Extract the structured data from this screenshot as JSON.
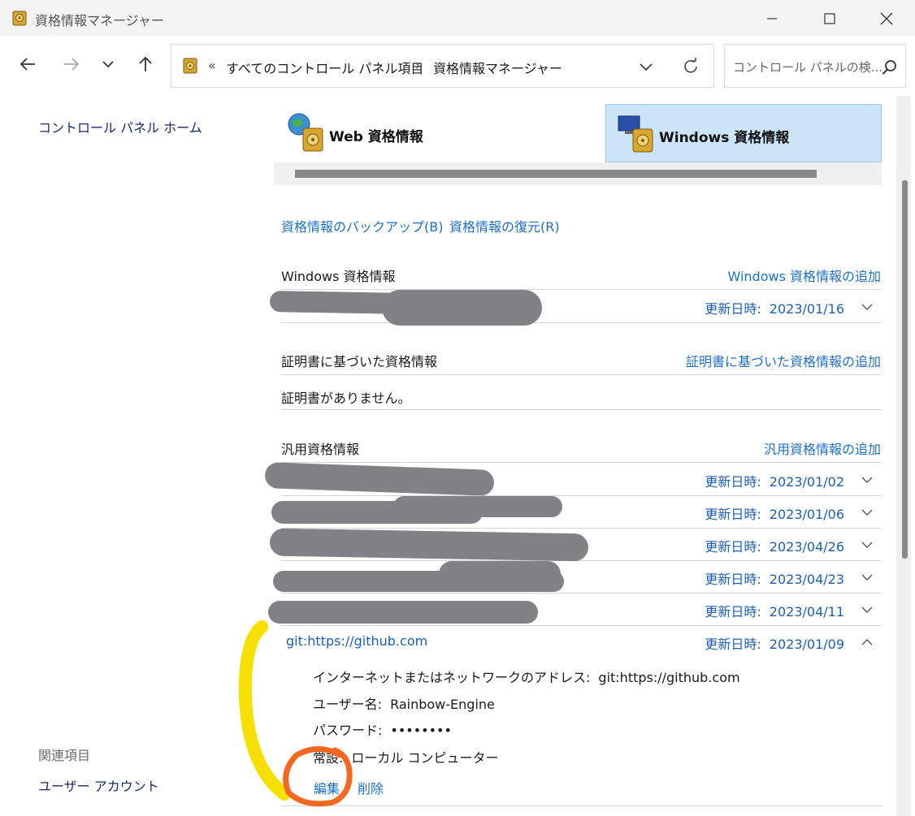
{
  "window": {
    "title": "資格情報マネージャー",
    "icon": "credential-vault-icon"
  },
  "nav": {
    "crumb_separator": "«",
    "crumb_separator2": "›",
    "crumbs": [
      "すべてのコントロール パネル項目",
      "資格情報マネージャー"
    ],
    "search_placeholder": "コントロール パネルの検..."
  },
  "sidebar": {
    "home_link": "コントロール パネル ホーム",
    "related_heading": "関連項目",
    "user_accounts_link": "ユーザー アカウント"
  },
  "tabs": [
    {
      "label": "Web 資格情報",
      "icon": "web-credential-icon",
      "selected": false
    },
    {
      "label": "Windows 資格情報",
      "icon": "windows-credential-icon",
      "selected": true
    }
  ],
  "actions": {
    "backup": "資格情報のバックアップ(B)",
    "restore": "資格情報の復元(R)"
  },
  "sections": {
    "windows": {
      "title": "Windows 資格情報",
      "add": "Windows 資格情報の追加",
      "items": [
        {
          "updated_label": "更新日時:",
          "date": "2023/01/16"
        }
      ]
    },
    "certificate": {
      "title": "証明書に基づいた資格情報",
      "add": "証明書に基づいた資格情報の追加",
      "empty": "証明書がありません。"
    },
    "generic": {
      "title": "汎用資格情報",
      "add": "汎用資格情報の追加",
      "items": [
        {
          "updated_label": "更新日時:",
          "date": "2023/01/02"
        },
        {
          "updated_label": "更新日時:",
          "date": "2023/01/06"
        },
        {
          "updated_label": "更新日時:",
          "date": "2023/04/26"
        },
        {
          "updated_label": "更新日時:",
          "date": "2023/04/23"
        },
        {
          "updated_label": "更新日時:",
          "date": "2023/04/11"
        },
        {
          "name": "git:https://github.com",
          "updated_label": "更新日時:",
          "date": "2023/01/09",
          "expanded": true
        }
      ],
      "expanded_detail": {
        "address_label": "インターネットまたはネットワークのアドレス:",
        "address_value": "git:https://github.com",
        "user_label": "ユーザー名:",
        "user_value": "Rainbow-Engine",
        "password_label": "パスワード:",
        "password_value": "••••••••",
        "persist_label": "常設:",
        "persist_value": "ローカル コンピューター",
        "edit": "編集",
        "delete": "削除"
      }
    }
  },
  "colors": {
    "link": "#1d6fc6",
    "selected_tab": "#cce4f7",
    "redaction": "#808285",
    "highlight_yellow": "#f7e000",
    "highlight_orange": "#f26a21"
  }
}
